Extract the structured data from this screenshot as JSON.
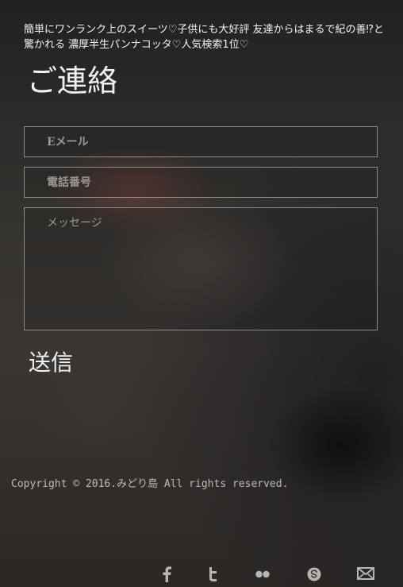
{
  "headline": "簡単にワンランク上のスイーツ♡子供にも大好評 友達からはまるで紀の善⁉と驚かれる 濃厚半生パンナコッタ♡人気検索1位♡",
  "contact": {
    "title": "ご連絡",
    "email_placeholder": "Eメール",
    "phone_placeholder": "電話番号",
    "message_placeholder": "メッセージ",
    "submit_label": "送信"
  },
  "footer": {
    "copyright": "Copyright © 2016.みどり島 All rights reserved.",
    "social_icons": [
      "facebook-icon",
      "twitter-icon",
      "flickr-icon",
      "skype-icon",
      "mail-icon"
    ]
  },
  "colors": {
    "text": "#f2f2f2",
    "field_border": "#8e8c89",
    "icon": "#b8b6b3"
  }
}
